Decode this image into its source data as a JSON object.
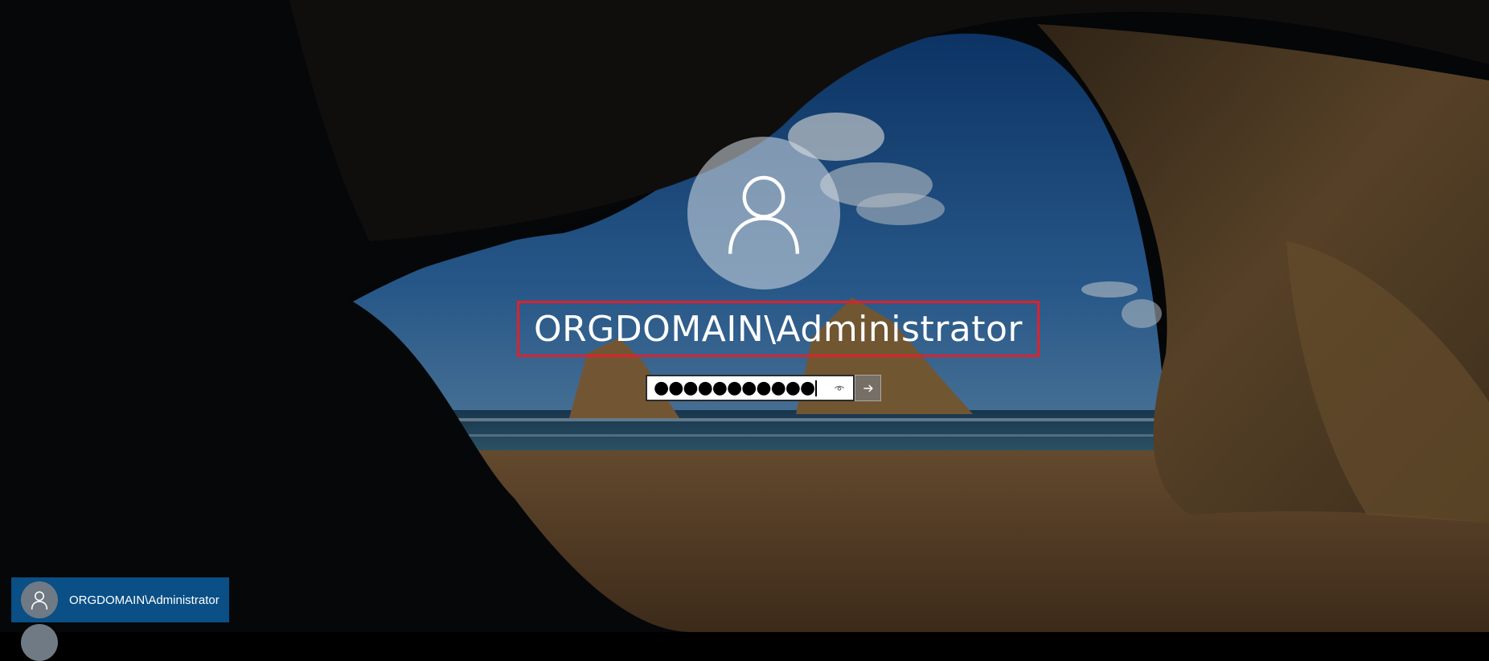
{
  "login": {
    "username": "ORGDOMAIN\\Administrator",
    "password_mask": "●●●●●●●●●●●",
    "icons": {
      "avatar": "user-avatar-icon",
      "reveal": "eye-icon",
      "submit": "arrow-right-icon"
    }
  },
  "user_list": {
    "items": [
      {
        "label": "ORGDOMAIN\\Administrator",
        "selected": true
      },
      {
        "label": "",
        "selected": false
      }
    ]
  },
  "colors": {
    "highlight_border": "#e0202c",
    "selected_tile": "#0a4f86"
  }
}
